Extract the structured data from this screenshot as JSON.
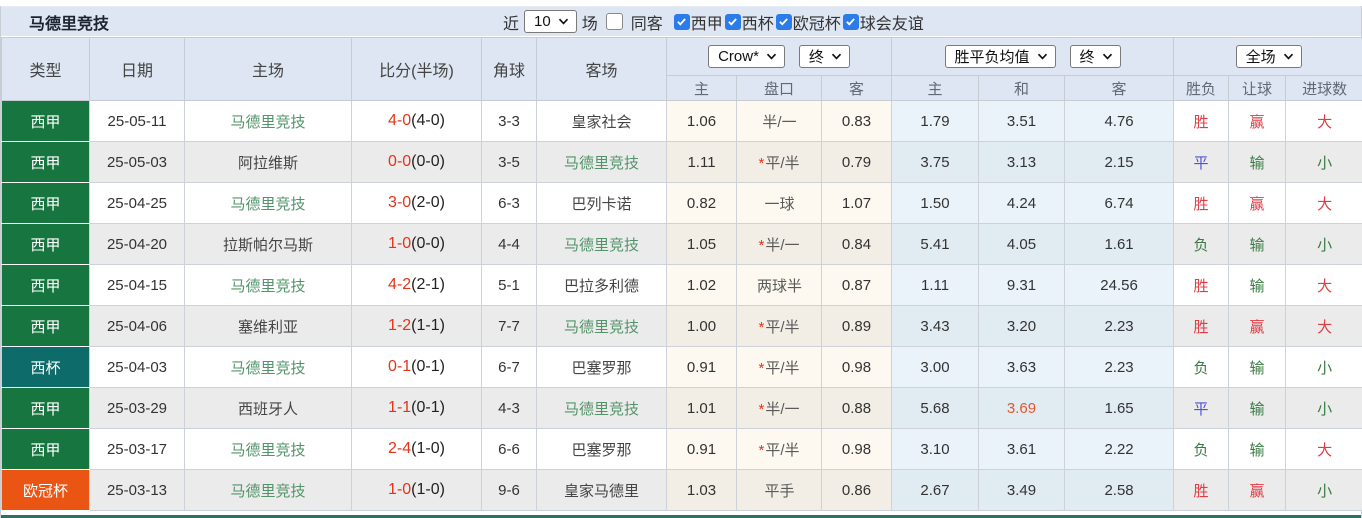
{
  "toolbar": {
    "title": "马德里竞技",
    "recent_label": "近",
    "recent_value": "10",
    "matches_label": "场",
    "same_away_label": "同客",
    "filters": [
      {
        "label": "西甲",
        "checked": true
      },
      {
        "label": "西杯",
        "checked": true
      },
      {
        "label": "欧冠杯",
        "checked": true
      },
      {
        "label": "球会友谊",
        "checked": true
      }
    ]
  },
  "header": {
    "type": "类型",
    "date": "日期",
    "home": "主场",
    "score": "比分(半场)",
    "corner": "角球",
    "away": "客场",
    "odds_company_select": "Crow*",
    "odds_time_select": "终",
    "wdl_select": "胜平负均值",
    "wdl_time_select": "终",
    "scope_select": "全场",
    "sub": {
      "odds_home": "主",
      "handicap": "盘口",
      "odds_away": "客",
      "wdl_home": "主",
      "wdl_draw": "和",
      "wdl_away": "客",
      "winloss": "胜负",
      "handicap_result": "让球",
      "goals": "进球数"
    }
  },
  "colors": {
    "league": {
      "西甲": "#17753f",
      "西杯": "#0d6b69",
      "欧冠杯": "#ea5514"
    },
    "result": {
      "胜": "#e23b43",
      "平": "#4f51d8",
      "负": "#3a7b44",
      "赢": "#e23b43",
      "输": "#3a7b44",
      "大": "#e23b43",
      "小": "#3a7b44"
    },
    "subject_team": "#52946a",
    "score_red": "#e5331a",
    "highlight_odds": "#e5562e"
  },
  "rows": [
    {
      "type": "西甲",
      "date": "25-05-11",
      "home": "马德里竞技",
      "score": "4-0",
      "half": "(4-0)",
      "corner": "3-3",
      "away": "皇家社会",
      "odds_home": "1.06",
      "handicap_star": "",
      "handicap": "半/一",
      "odds_away": "0.83",
      "wdl_home": "1.79",
      "wdl_draw": "3.51",
      "wdl_away": "4.76",
      "wdl_draw_red": false,
      "winloss": "胜",
      "handicap_result": "赢",
      "goals": "大"
    },
    {
      "type": "西甲",
      "date": "25-05-03",
      "home": "阿拉维斯",
      "score": "0-0",
      "half": "(0-0)",
      "corner": "3-5",
      "away": "马德里竞技",
      "odds_home": "1.11",
      "handicap_star": "*",
      "handicap": "平/半",
      "odds_away": "0.79",
      "wdl_home": "3.75",
      "wdl_draw": "3.13",
      "wdl_away": "2.15",
      "wdl_draw_red": false,
      "winloss": "平",
      "handicap_result": "输",
      "goals": "小"
    },
    {
      "type": "西甲",
      "date": "25-04-25",
      "home": "马德里竞技",
      "score": "3-0",
      "half": "(2-0)",
      "corner": "6-3",
      "away": "巴列卡诺",
      "odds_home": "0.82",
      "handicap_star": "",
      "handicap": "一球",
      "odds_away": "1.07",
      "wdl_home": "1.50",
      "wdl_draw": "4.24",
      "wdl_away": "6.74",
      "wdl_draw_red": false,
      "winloss": "胜",
      "handicap_result": "赢",
      "goals": "大"
    },
    {
      "type": "西甲",
      "date": "25-04-20",
      "home": "拉斯帕尔马斯",
      "score": "1-0",
      "half": "(0-0)",
      "corner": "4-4",
      "away": "马德里竞技",
      "odds_home": "1.05",
      "handicap_star": "*",
      "handicap": "半/一",
      "odds_away": "0.84",
      "wdl_home": "5.41",
      "wdl_draw": "4.05",
      "wdl_away": "1.61",
      "wdl_draw_red": false,
      "winloss": "负",
      "handicap_result": "输",
      "goals": "小"
    },
    {
      "type": "西甲",
      "date": "25-04-15",
      "home": "马德里竞技",
      "score": "4-2",
      "half": "(2-1)",
      "corner": "5-1",
      "away": "巴拉多利德",
      "odds_home": "1.02",
      "handicap_star": "",
      "handicap": "两球半",
      "odds_away": "0.87",
      "wdl_home": "1.11",
      "wdl_draw": "9.31",
      "wdl_away": "24.56",
      "wdl_draw_red": false,
      "winloss": "胜",
      "handicap_result": "输",
      "goals": "大"
    },
    {
      "type": "西甲",
      "date": "25-04-06",
      "home": "塞维利亚",
      "score": "1-2",
      "half": "(1-1)",
      "corner": "7-7",
      "away": "马德里竞技",
      "odds_home": "1.00",
      "handicap_star": "*",
      "handicap": "平/半",
      "odds_away": "0.89",
      "wdl_home": "3.43",
      "wdl_draw": "3.20",
      "wdl_away": "2.23",
      "wdl_draw_red": false,
      "winloss": "胜",
      "handicap_result": "赢",
      "goals": "大"
    },
    {
      "type": "西杯",
      "date": "25-04-03",
      "home": "马德里竞技",
      "score": "0-1",
      "half": "(0-1)",
      "corner": "6-7",
      "away": "巴塞罗那",
      "odds_home": "0.91",
      "handicap_star": "*",
      "handicap": "平/半",
      "odds_away": "0.98",
      "wdl_home": "3.00",
      "wdl_draw": "3.63",
      "wdl_away": "2.23",
      "wdl_draw_red": false,
      "winloss": "负",
      "handicap_result": "输",
      "goals": "小"
    },
    {
      "type": "西甲",
      "date": "25-03-29",
      "home": "西班牙人",
      "score": "1-1",
      "half": "(0-1)",
      "corner": "4-3",
      "away": "马德里竞技",
      "odds_home": "1.01",
      "handicap_star": "*",
      "handicap": "半/一",
      "odds_away": "0.88",
      "wdl_home": "5.68",
      "wdl_draw": "3.69",
      "wdl_away": "1.65",
      "wdl_draw_red": true,
      "winloss": "平",
      "handicap_result": "输",
      "goals": "小"
    },
    {
      "type": "西甲",
      "date": "25-03-17",
      "home": "马德里竞技",
      "score": "2-4",
      "half": "(1-0)",
      "corner": "6-6",
      "away": "巴塞罗那",
      "odds_home": "0.91",
      "handicap_star": "*",
      "handicap": "平/半",
      "odds_away": "0.98",
      "wdl_home": "3.10",
      "wdl_draw": "3.61",
      "wdl_away": "2.22",
      "wdl_draw_red": false,
      "winloss": "负",
      "handicap_result": "输",
      "goals": "大"
    },
    {
      "type": "欧冠杯",
      "date": "25-03-13",
      "home": "马德里竞技",
      "score": "1-0",
      "half": "(1-0)",
      "corner": "9-6",
      "away": "皇家马德里",
      "odds_home": "1.03",
      "handicap_star": "",
      "handicap": "平手",
      "odds_away": "0.86",
      "wdl_home": "2.67",
      "wdl_draw": "3.49",
      "wdl_away": "2.58",
      "wdl_draw_red": false,
      "winloss": "胜",
      "handicap_result": "赢",
      "goals": "小"
    }
  ]
}
